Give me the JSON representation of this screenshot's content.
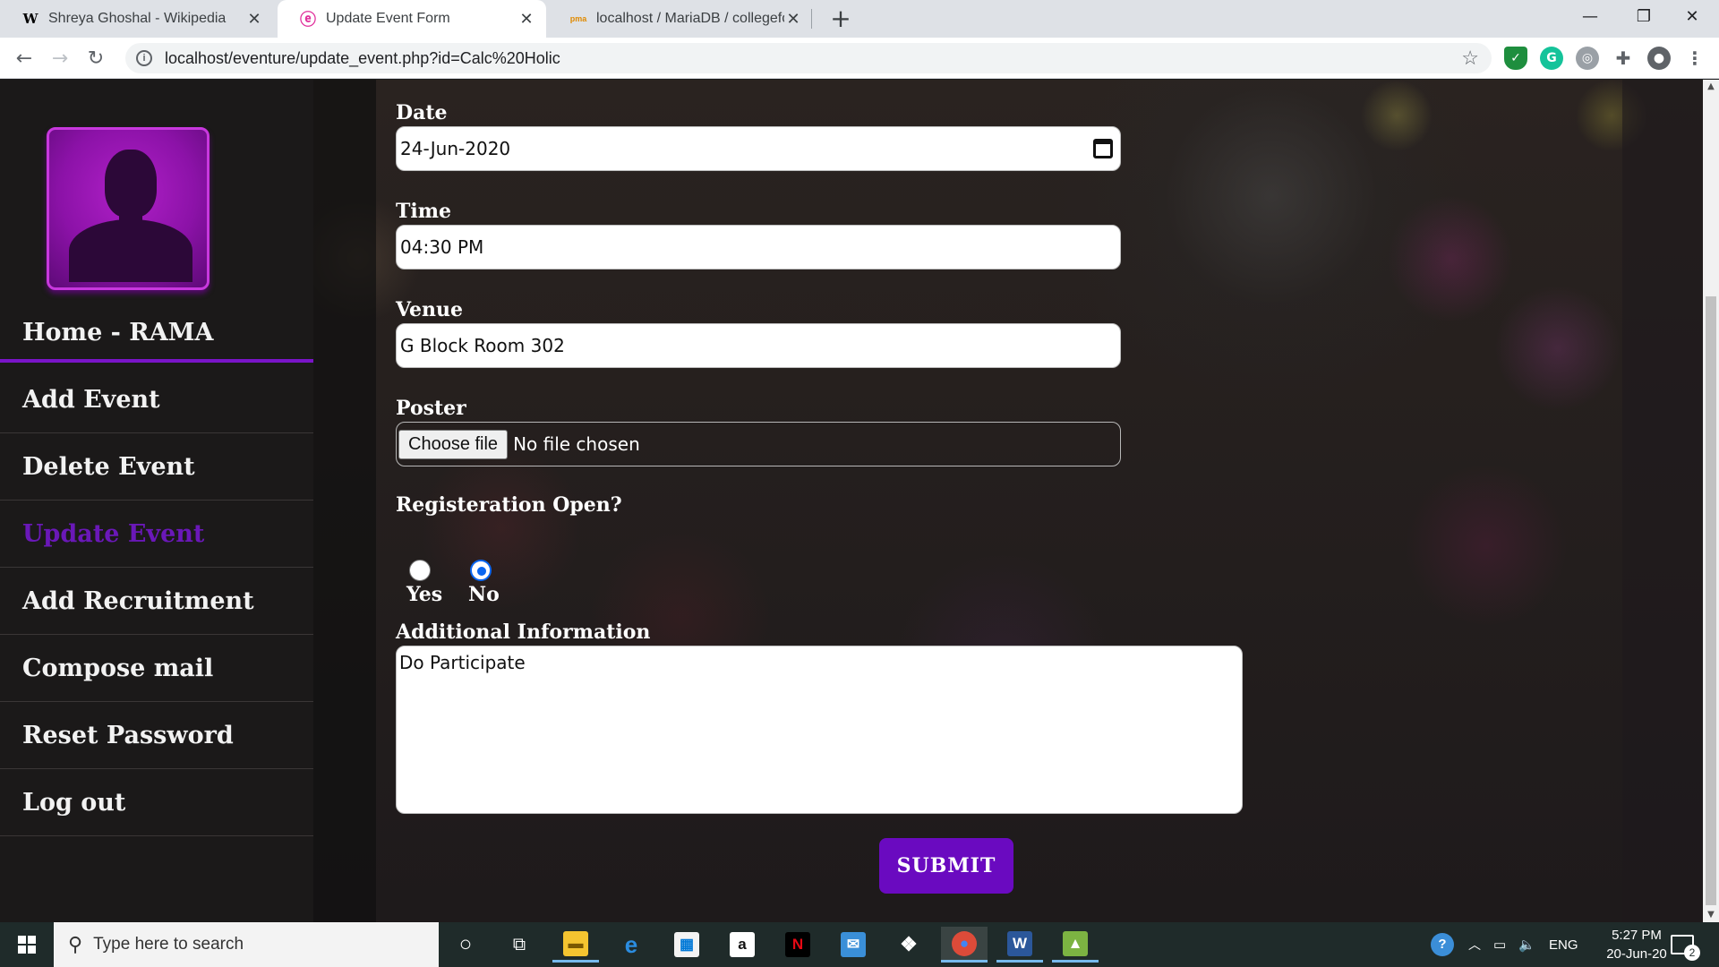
{
  "browser": {
    "tabs": [
      {
        "title": "Shreya Ghoshal - Wikipedia",
        "favicon": "W",
        "active": false
      },
      {
        "title": "Update Event Form",
        "favicon": "ⓔ",
        "active": true
      },
      {
        "title": "localhost / MariaDB / collegeforu",
        "favicon": "pma",
        "active": false
      }
    ],
    "new_tab": "+",
    "url": "localhost/eventure/update_event.php?id=Calc%20Holic"
  },
  "sidebar": {
    "home_label": "Home - RAMA",
    "items": [
      {
        "label": "Add Event",
        "active": false
      },
      {
        "label": "Delete Event",
        "active": false
      },
      {
        "label": "Update Event",
        "active": true
      },
      {
        "label": "Add Recruitment",
        "active": false
      },
      {
        "label": "Compose mail",
        "active": false
      },
      {
        "label": "Reset Password",
        "active": false
      },
      {
        "label": "Log out",
        "active": false
      }
    ]
  },
  "form": {
    "date_label": "Date",
    "date_value": "24-Jun-2020",
    "time_label": "Time",
    "time_value": "04:30 PM",
    "venue_label": "Venue",
    "venue_value": "G Block Room 302",
    "poster_label": "Poster",
    "choose_file": "Choose file",
    "no_file": "No file chosen",
    "registration_label": "Registeration Open?",
    "options": [
      {
        "label": "Yes",
        "checked": false
      },
      {
        "label": "No",
        "checked": true
      }
    ],
    "info_label": "Additional Information",
    "info_value": "Do Participate",
    "submit": "SUBMIT"
  },
  "taskbar": {
    "search_placeholder": "Type here to search",
    "language": "ENG",
    "time": "5:27 PM",
    "date": "20-Jun-20",
    "notifications": "2"
  },
  "colors": {
    "accent": "#6a0ac0",
    "active_menu": "#6a18b8",
    "sidebar_bg": "#1b1919"
  }
}
